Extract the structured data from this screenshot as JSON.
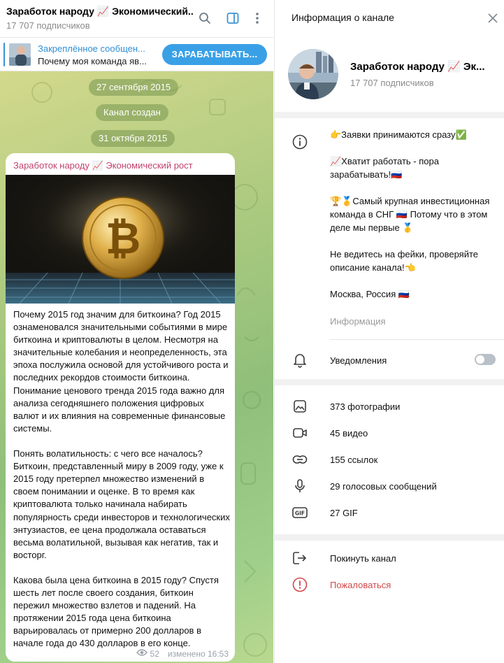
{
  "chat": {
    "title": "Заработок народу 📈 Экономический...",
    "subscribers": "17 707 подписчиков",
    "icons": [
      "search-icon",
      "sidebar-toggle-icon",
      "more-vertical-icon"
    ]
  },
  "pinned": {
    "title": "Закреплённое сообщен...",
    "text": "Почему моя команда яв...",
    "button": "ЗАРАБАТЫВАТЬ..."
  },
  "dates": [
    "27 сентября 2015",
    "Канал создан",
    "31 октября 2015"
  ],
  "message": {
    "author": "Заработок народу 📈 Экономический рост",
    "paragraphs": [
      "Почему 2015 год значим для биткоина? Год 2015 ознаменовался значительными событиями в мире биткоина и криптовалюты в целом. Несмотря на значительные колебания и неопределенность, эта эпоха послужила основой для устойчивого роста и последних рекордов стоимости биткоина. Понимание ценового тренда 2015 года важно для анализа сегодняшнего положения цифровых валют и их влияния на современные финансовые системы.",
      "Понять волатильность: с чего все началось? Биткоин, представленный миру в 2009 году, уже к 2015 году претерпел множество изменений в своем понимании и оценке. В то время как криптовалюта только начинала набирать популярность среди инвесторов и технологических энтузиастов, ее цена продолжала оставаться весьма волатильной, вызывая как негатив, так и восторг.",
      "Какова была цена биткоина в 2015 году? Спустя шесть лет после своего создания, биткоин пережил множество взлетов и падений. На протяжении 2015 года цена биткоина варьировалась от примерно 200 долларов в начале года до 430 долларов в его конце."
    ],
    "views": "52",
    "edited": "изменено 16:53",
    "accent": "#c2426e"
  },
  "info": {
    "title": "Информация о канале",
    "channel_name": "Заработок народу 📈 Эк...",
    "subscribers": "17 707 подписчиков",
    "description_lines": [
      "👉Заявки принимаются сразу✅",
      "",
      "📈Хватит работать - пора зарабатывать!🇷🇺",
      "",
      "🏆🥇Самый крупная инвестиционная команда в СНГ 🇷🇺 Потому что в этом деле мы первые 🥇",
      "",
      "Не ведитесь на фейки, проверяйте описание канала!👈",
      "",
      "Москва, Россия 🇷🇺"
    ],
    "description_label": "Информация",
    "notifications_label": "Уведомления",
    "notifications_on": false,
    "media": [
      {
        "icon": "photo-icon",
        "label": "373 фотографии"
      },
      {
        "icon": "video-icon",
        "label": "45 видео"
      },
      {
        "icon": "link-icon",
        "label": "155 ссылок"
      },
      {
        "icon": "microphone-icon",
        "label": "29 голосовых сообщений"
      },
      {
        "icon": "gif-icon",
        "label": "27 GIF"
      }
    ],
    "leave_label": "Покинуть канал",
    "report_label": "Пожаловаться",
    "danger_color": "#d24848"
  }
}
